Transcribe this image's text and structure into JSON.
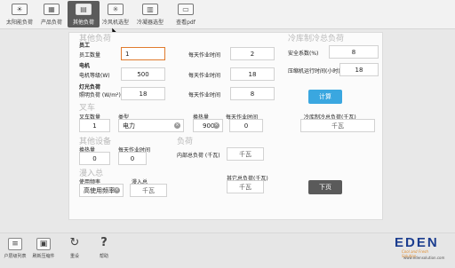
{
  "toolbar": {
    "items": [
      {
        "label": "太阳能负荷"
      },
      {
        "label": "产品负荷"
      },
      {
        "label": "其他负荷"
      },
      {
        "label": "冷风机选型"
      },
      {
        "label": "冷凝器选型"
      },
      {
        "label": "查看pdf"
      }
    ]
  },
  "other_load": {
    "section_title": "其他负荷",
    "staff": {
      "title": "员工",
      "count_label": "员工数量",
      "count_value": "1",
      "hours_label": "每天作业时间",
      "hours_value": "2"
    },
    "motor": {
      "title": "电机",
      "power_label": "电机等级(W)",
      "power_value": "500",
      "hours_label": "每天作业时间",
      "hours_value": "18"
    },
    "lighting": {
      "title": "灯光负荷",
      "power_label": "照明负荷 (W/m²)",
      "power_value": "18",
      "hours_label": "每天作业时间",
      "hours_value": "8"
    }
  },
  "total_cooling": {
    "section_title": "冷库制冷总负荷",
    "safety_label": "安全系数(%)",
    "safety_value": "8",
    "compressor_label": "压缩机运行时间(小时)",
    "compressor_value": "18",
    "calc_button": "计算",
    "total_label": "冷库制冷总负荷(千瓦)",
    "total_value": "千瓦"
  },
  "forklift": {
    "section_title": "叉车",
    "count_label": "叉车数量",
    "count_value": "1",
    "type_label": "类型",
    "type_value": "电力",
    "heat_label": "换热量",
    "heat_value": "900",
    "hours_label": "每天作业时间",
    "hours_value": "0"
  },
  "other_equipment": {
    "section_title": "其他设备",
    "heat_label": "换热量",
    "heat_value": "0",
    "hours_label": "每天作业时间",
    "hours_value": "0"
  },
  "load": {
    "section_title": "负荷",
    "internal_label": "内部总负荷 (千瓦)",
    "internal_value": "千瓦"
  },
  "infiltration": {
    "section_title": "漫入总",
    "freq_label": "使用频率",
    "freq_value": "高使用频率",
    "total_label": "漫入总",
    "total_value": "千瓦"
  },
  "other_total": {
    "label": "其它总负荷(千瓦)",
    "value": "千瓦"
  },
  "next_button": "下页",
  "bottombar": {
    "items": [
      {
        "label": "户层级列表"
      },
      {
        "label": "刷新压缩件"
      },
      {
        "label": "重设"
      },
      {
        "label": "帮助"
      }
    ]
  },
  "brand": {
    "logo": "EDEN",
    "tagline": "Cool and Fresh Solution",
    "url": "www.edensolution.com"
  },
  "colors": {
    "accent_blue": "#3aa7e0",
    "focus_orange": "#e07b2e",
    "button_dark": "#5a5a5a",
    "brand_blue": "#1b3d8f"
  }
}
